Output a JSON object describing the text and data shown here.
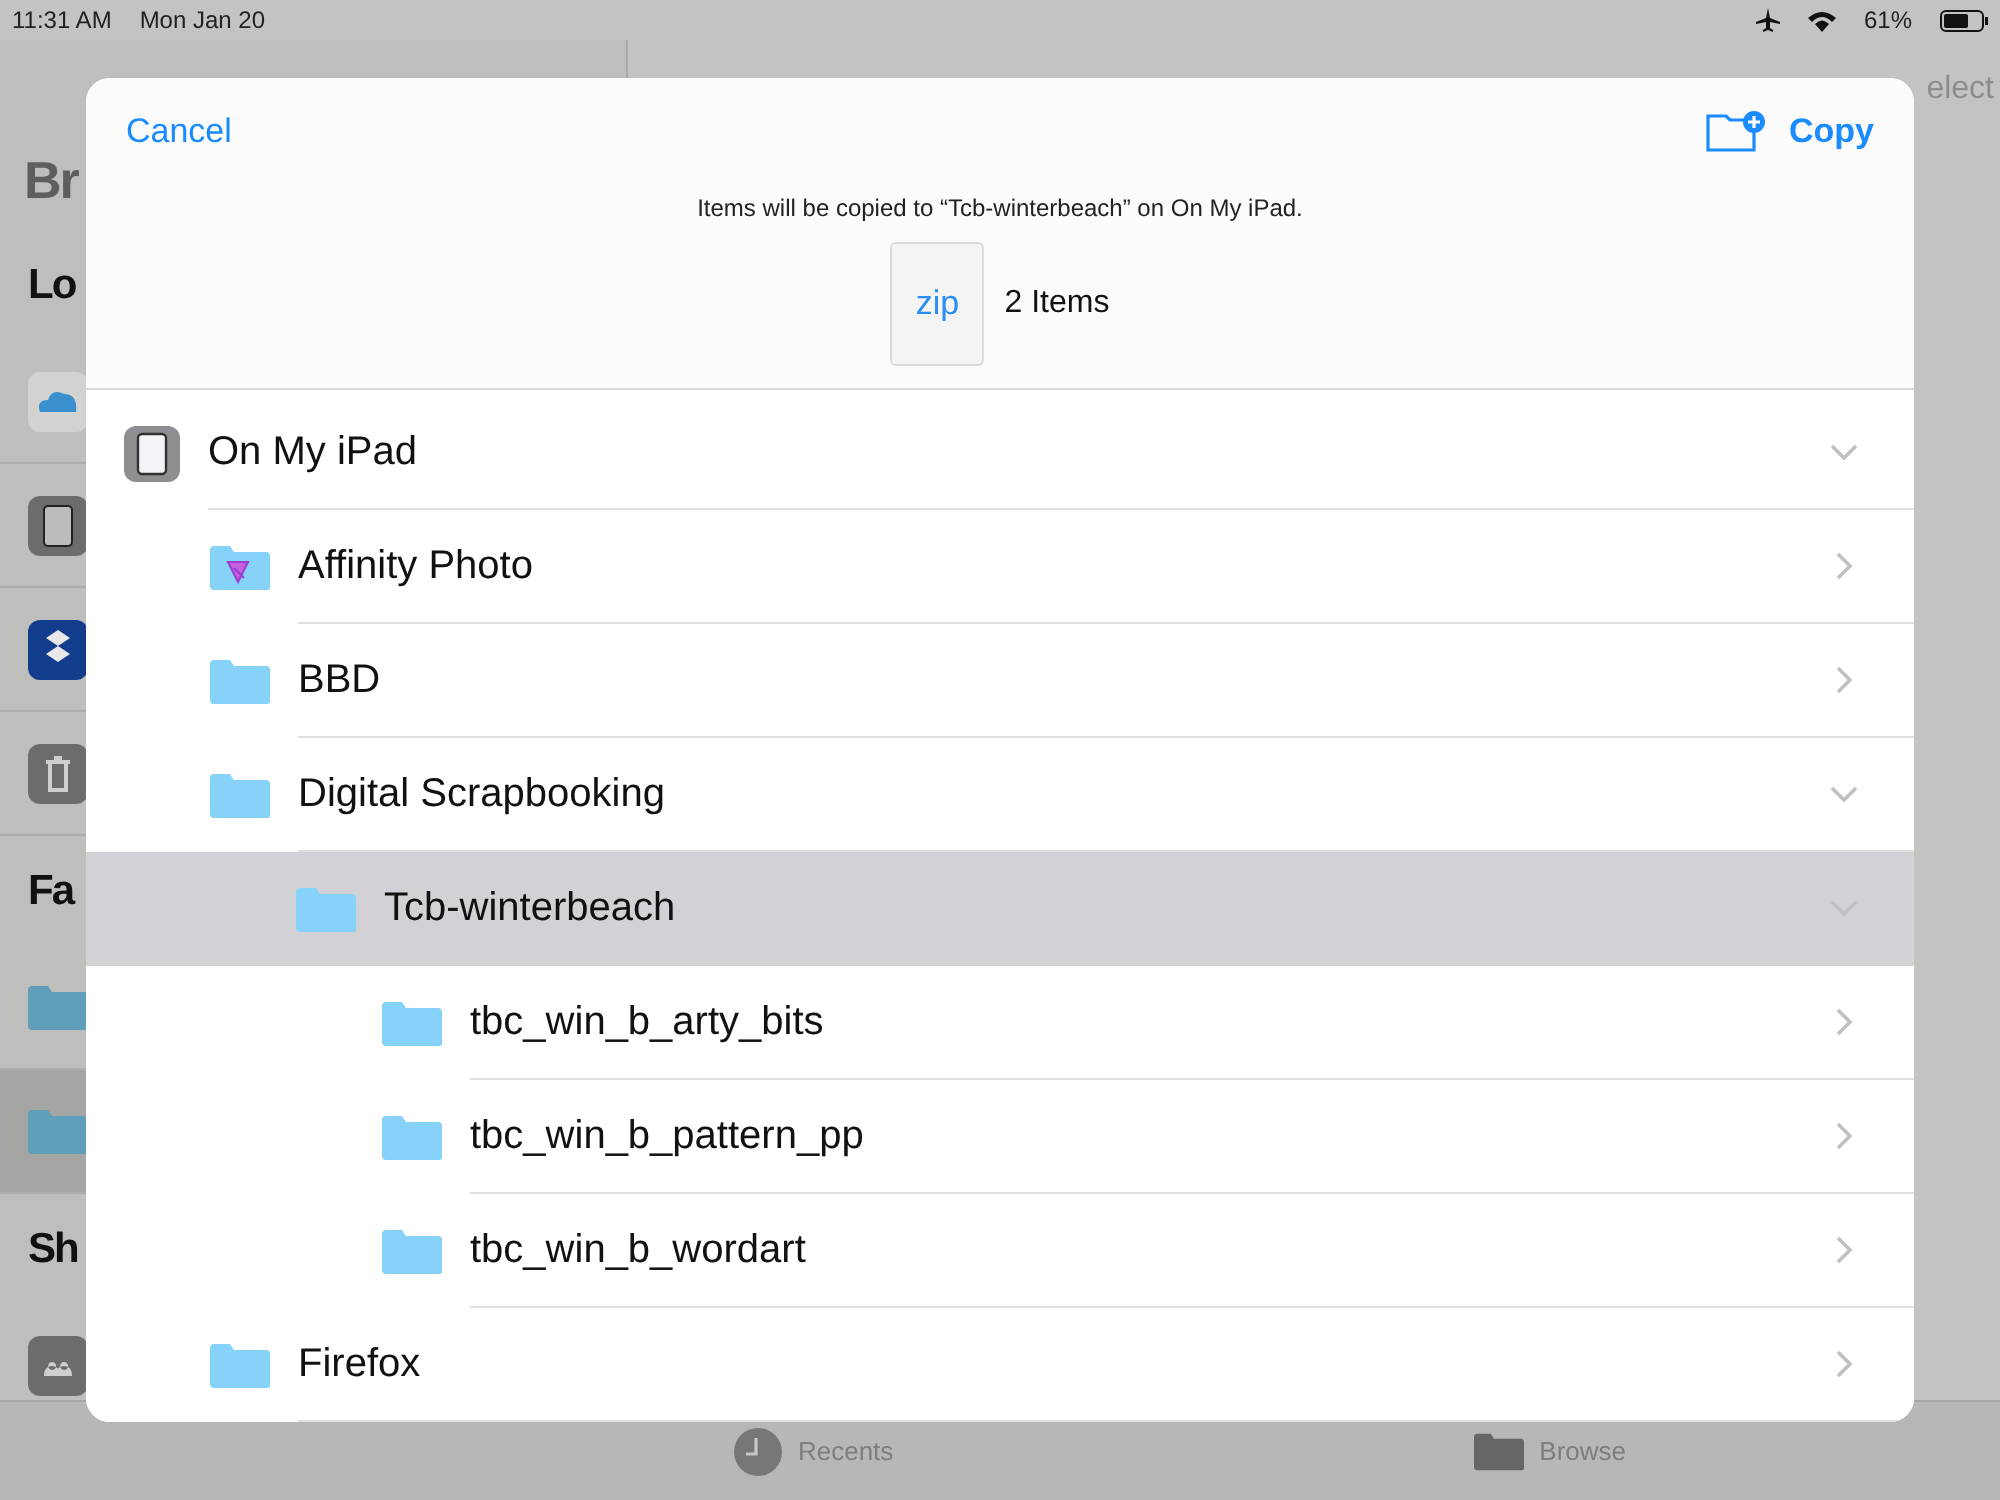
{
  "status_bar": {
    "time": "11:31 AM",
    "date": "Mon Jan 20",
    "battery": "61%"
  },
  "sidebar": {
    "items": [
      {
        "kind": "title",
        "label": "Br"
      },
      {
        "kind": "heading",
        "label": "Lo"
      },
      {
        "kind": "cloud",
        "selected": false
      },
      {
        "kind": "ipad",
        "selected": false
      },
      {
        "kind": "dropbox",
        "selected": false
      },
      {
        "kind": "trash",
        "selected": false
      },
      {
        "kind": "heading",
        "label": "Fa"
      },
      {
        "kind": "folder",
        "selected": false
      },
      {
        "kind": "folder",
        "selected": true
      },
      {
        "kind": "heading",
        "label": "Sh"
      },
      {
        "kind": "shared",
        "selected": false
      }
    ]
  },
  "content": {
    "select": "elect"
  },
  "tab_bar": [
    {
      "kind": "clock",
      "label": "Recents"
    },
    {
      "kind": "folder",
      "label": "Browse"
    }
  ],
  "sheet": {
    "cancel": "Cancel",
    "copy": "Copy",
    "message": "Items will be copied to “Tcb-winterbeach” on On My iPad.",
    "file_badge": "zip",
    "item_count": "2 Items",
    "tree": [
      {
        "kind": "ipad",
        "label": "On My iPad",
        "expanded": true,
        "selected": false,
        "children": [
          {
            "kind": "affinity",
            "label": "Affinity Photo",
            "expanded": false,
            "selected": false
          },
          {
            "kind": "folder",
            "label": "BBD",
            "expanded": false,
            "selected": false
          },
          {
            "kind": "folder",
            "label": "Digital Scrapbooking",
            "expanded": true,
            "selected": false,
            "children": [
              {
                "kind": "folder",
                "label": "Tcb-winterbeach",
                "expanded": true,
                "selected": true,
                "children": [
                  {
                    "kind": "folder",
                    "label": "tbc_win_b_arty_bits",
                    "expanded": false,
                    "selected": false
                  },
                  {
                    "kind": "folder",
                    "label": "tbc_win_b_pattern_pp",
                    "expanded": false,
                    "selected": false
                  },
                  {
                    "kind": "folder",
                    "label": "tbc_win_b_wordart",
                    "expanded": false,
                    "selected": false
                  }
                ]
              }
            ]
          },
          {
            "kind": "folder",
            "label": "Firefox",
            "expanded": false,
            "selected": false
          }
        ]
      }
    ]
  }
}
